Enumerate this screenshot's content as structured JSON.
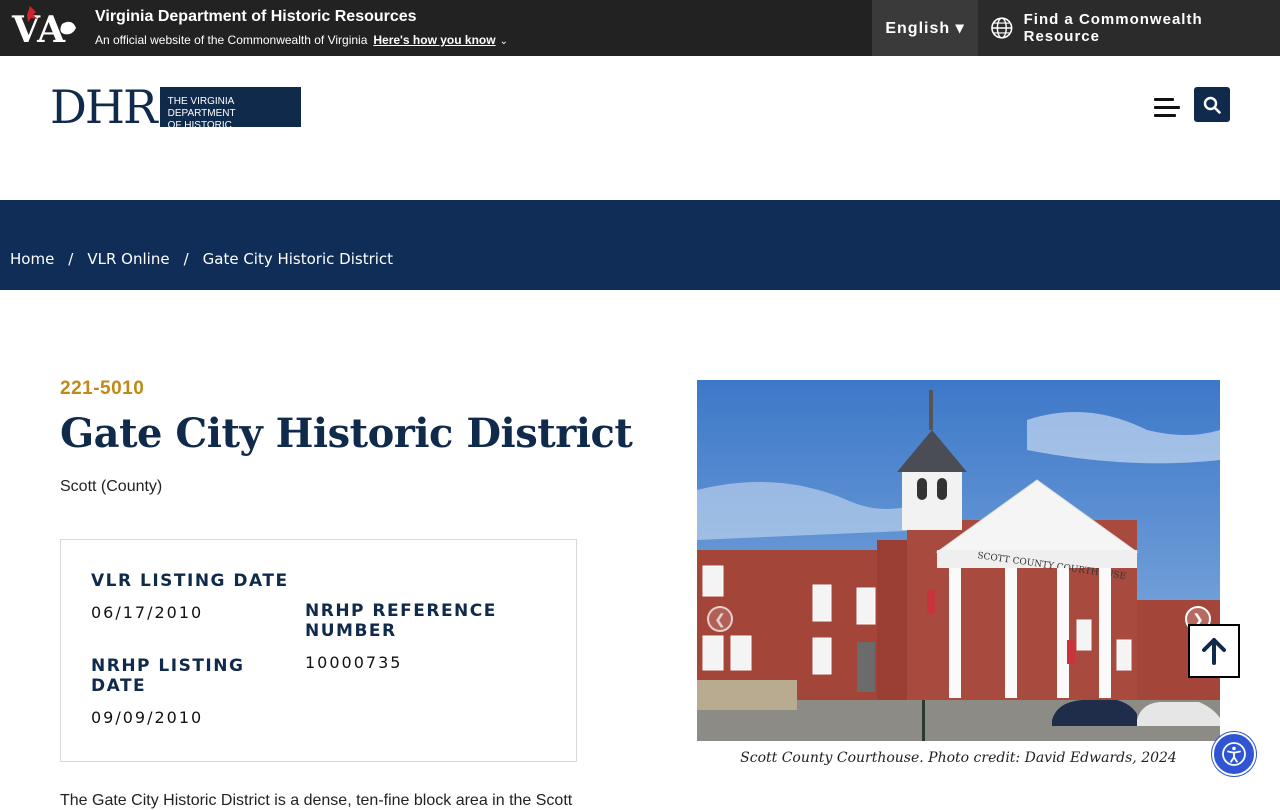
{
  "topbar": {
    "agency_name": "Virginia Department of Historic Resources",
    "official_text": "An official website of the Commonwealth of Virginia",
    "how_you_know": "Here's how you know",
    "language": "English ▾",
    "find_resource": "Find a Commonwealth Resource",
    "logo_text": "VA"
  },
  "header": {
    "logo_letters": "DHR",
    "logo_tagline_line1": "THE VIRGINIA DEPARTMENT",
    "logo_tagline_line2": "OF HISTORIC RESOURCES",
    "menu_icon": "hamburger-icon",
    "search_icon": "search-icon"
  },
  "breadcrumb": {
    "items": [
      "Home",
      "VLR Online",
      "Gate City Historic District"
    ],
    "separator": "/"
  },
  "resource": {
    "id": "221-5010",
    "title": "Gate City Historic District",
    "county": "Scott (County)",
    "vlr_listing_date_label": "VLR LISTING DATE",
    "vlr_listing_date": "06/17/2010",
    "nrhp_listing_date_label_1": "NRHP LISTING",
    "nrhp_listing_date_label_2": "DATE",
    "nrhp_listing_date": "09/09/2010",
    "nrhp_ref_label_1": "NRHP REFERENCE",
    "nrhp_ref_label_2": "NUMBER",
    "nrhp_ref_number": "10000735",
    "intro": "The Gate City Historic District is a dense, ten-fine block area in the Scott"
  },
  "gallery": {
    "caption": "Scott County Courthouse. Photo credit: David Edwards, 2024",
    "sign_text": "SCOTT COUNTY COURTHOUSE"
  },
  "colors": {
    "navy": "#0f2d57",
    "gold": "#c08a17",
    "topbar": "#222222",
    "a11y_blue": "#2f55d4"
  }
}
